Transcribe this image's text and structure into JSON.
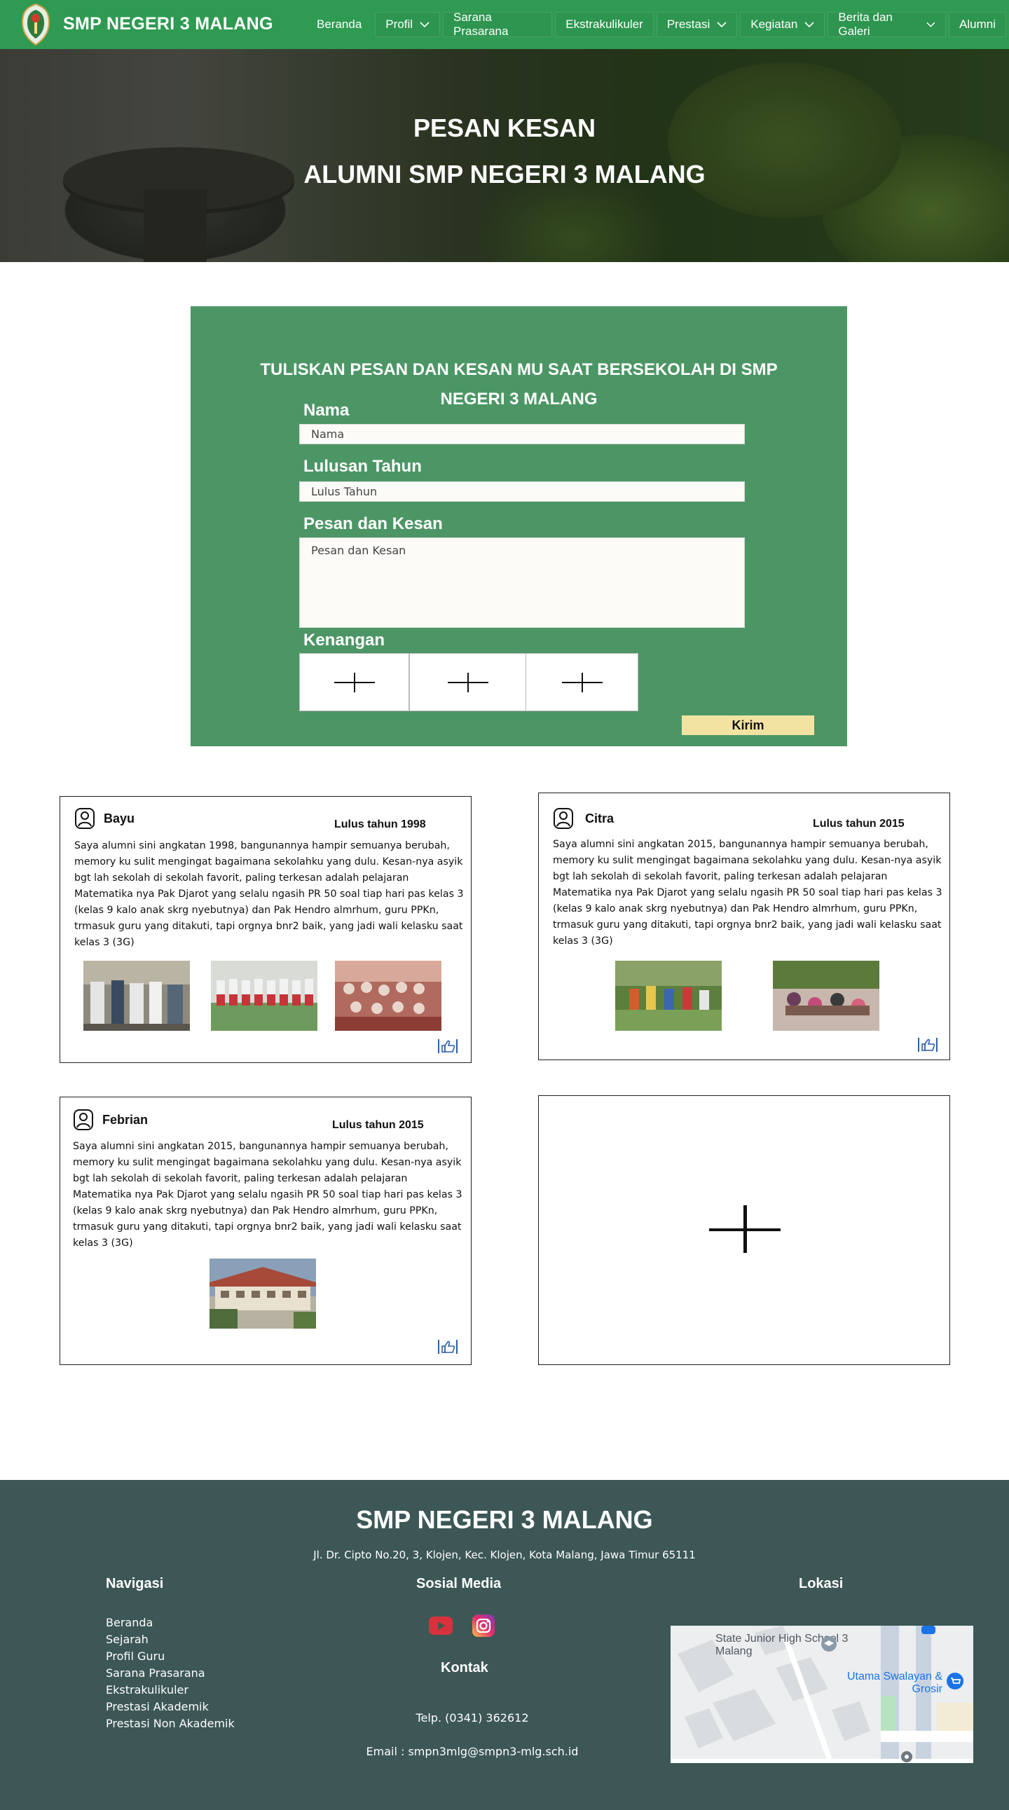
{
  "nav": {
    "brand": "SMP NEGERI 3 MALANG",
    "items": [
      {
        "label": "Beranda",
        "dropdown": false
      },
      {
        "label": "Profil",
        "dropdown": true
      },
      {
        "label": "Sarana Prasarana",
        "dropdown": false
      },
      {
        "label": "Ekstrakulikuler",
        "dropdown": false
      },
      {
        "label": "Prestasi",
        "dropdown": true
      },
      {
        "label": "Kegiatan",
        "dropdown": true
      },
      {
        "label": "Berita dan Galeri",
        "dropdown": true
      },
      {
        "label": "Alumni",
        "dropdown": false
      }
    ]
  },
  "hero": {
    "title": "PESAN KESAN",
    "subtitle": "ALUMNI SMP NEGERI 3 MALANG"
  },
  "form": {
    "title": "TULISKAN PESAN DAN KESAN MU SAAT BERSEKOLAH DI SMP NEGERI 3 MALANG",
    "name_label": "Nama",
    "name_placeholder": "Nama",
    "year_label": "Lulusan Tahun",
    "year_placeholder": "Lulus Tahun",
    "message_label": "Pesan dan Kesan",
    "message_placeholder": "Pesan dan Kesan",
    "memory_label": "Kenangan",
    "submit_label": "Kirim"
  },
  "testimonials": [
    {
      "name": "Bayu",
      "year": "Lulus tahun 1998",
      "text": "Saya alumni sini angkatan 1998, bangunannya hampir semuanya berubah, memory ku sulit mengingat bagaimana sekolahku yang dulu. Kesan-nya asyik bgt lah sekolah di sekolah favorit, paling terkesan adalah pelajaran Matematika nya Pak Djarot yang selalu ngasih PR 50 soal tiap hari pas kelas 3 (kelas 9 kalo anak skrg nyebutnya) dan Pak Hendro almrhum, guru PPKn, trmasuk guru yang ditakuti, tapi orgnya bnr2 baik, yang jadi wali kelasku saat kelas 3 (3G)"
    },
    {
      "name": "Citra",
      "year": "Lulus tahun 2015",
      "text": "Saya alumni sini angkatan 2015, bangunannya hampir semuanya berubah, memory ku sulit mengingat bagaimana sekolahku yang dulu. Kesan-nya asyik bgt lah sekolah di sekolah favorit, paling terkesan adalah pelajaran Matematika nya Pak Djarot yang selalu ngasih PR 50 soal tiap hari pas kelas 3 (kelas 9 kalo anak skrg nyebutnya) dan Pak Hendro almrhum, guru PPKn, trmasuk guru yang ditakuti, tapi orgnya bnr2 baik, yang jadi wali kelasku saat kelas 3 (3G)"
    },
    {
      "name": "Febrian",
      "year": "Lulus tahun 2015",
      "text": "Saya alumni sini angkatan 2015, bangunannya hampir semuanya berubah, memory ku sulit mengingat bagaimana sekolahku yang dulu. Kesan-nya asyik bgt lah sekolah di sekolah favorit, paling terkesan adalah pelajaran Matematika nya Pak Djarot yang selalu ngasih PR 50 soal tiap hari pas kelas 3 (kelas 9 kalo anak skrg nyebutnya) dan Pak Hendro almrhum, guru PPKn, trmasuk guru yang ditakuti, tapi orgnya bnr2 baik, yang jadi wali kelasku saat kelas 3 (3G)"
    }
  ],
  "footer": {
    "brand": "SMP NEGERI 3 MALANG",
    "address": "Jl. Dr. Cipto No.20, 3, Klojen, Kec. Klojen, Kota Malang, Jawa Timur 65111",
    "nav_heading": "Navigasi",
    "nav_links": [
      "Beranda",
      "Sejarah",
      "Profil Guru",
      "Sarana Prasarana",
      "Ekstrakulikuler",
      "Prestasi Akademik",
      "Prestasi Non Akademik"
    ],
    "social_heading": "Sosial Media",
    "contact_heading": "Kontak",
    "phone": "Telp. (0341) 362612",
    "email": "Email : smpn3mlg@smpn3-mlg.sch.id",
    "location_heading": "Lokasi",
    "map_label_school": "State Junior High School 3 Malang",
    "map_label_store": "Utama Swalayan & Grosir"
  },
  "colors": {
    "nav_green": "#2f9a52",
    "form_green": "#4c9665",
    "submit_yellow": "#f2e3a3",
    "footer_teal": "#3c5756",
    "like_blue": "#2d5fa8"
  },
  "icons": [
    "school-crest-logo",
    "chevron-down-icon",
    "plus-icon",
    "user-icon",
    "thumbs-up-icon",
    "youtube-icon",
    "instagram-icon",
    "map-pin-icon"
  ]
}
